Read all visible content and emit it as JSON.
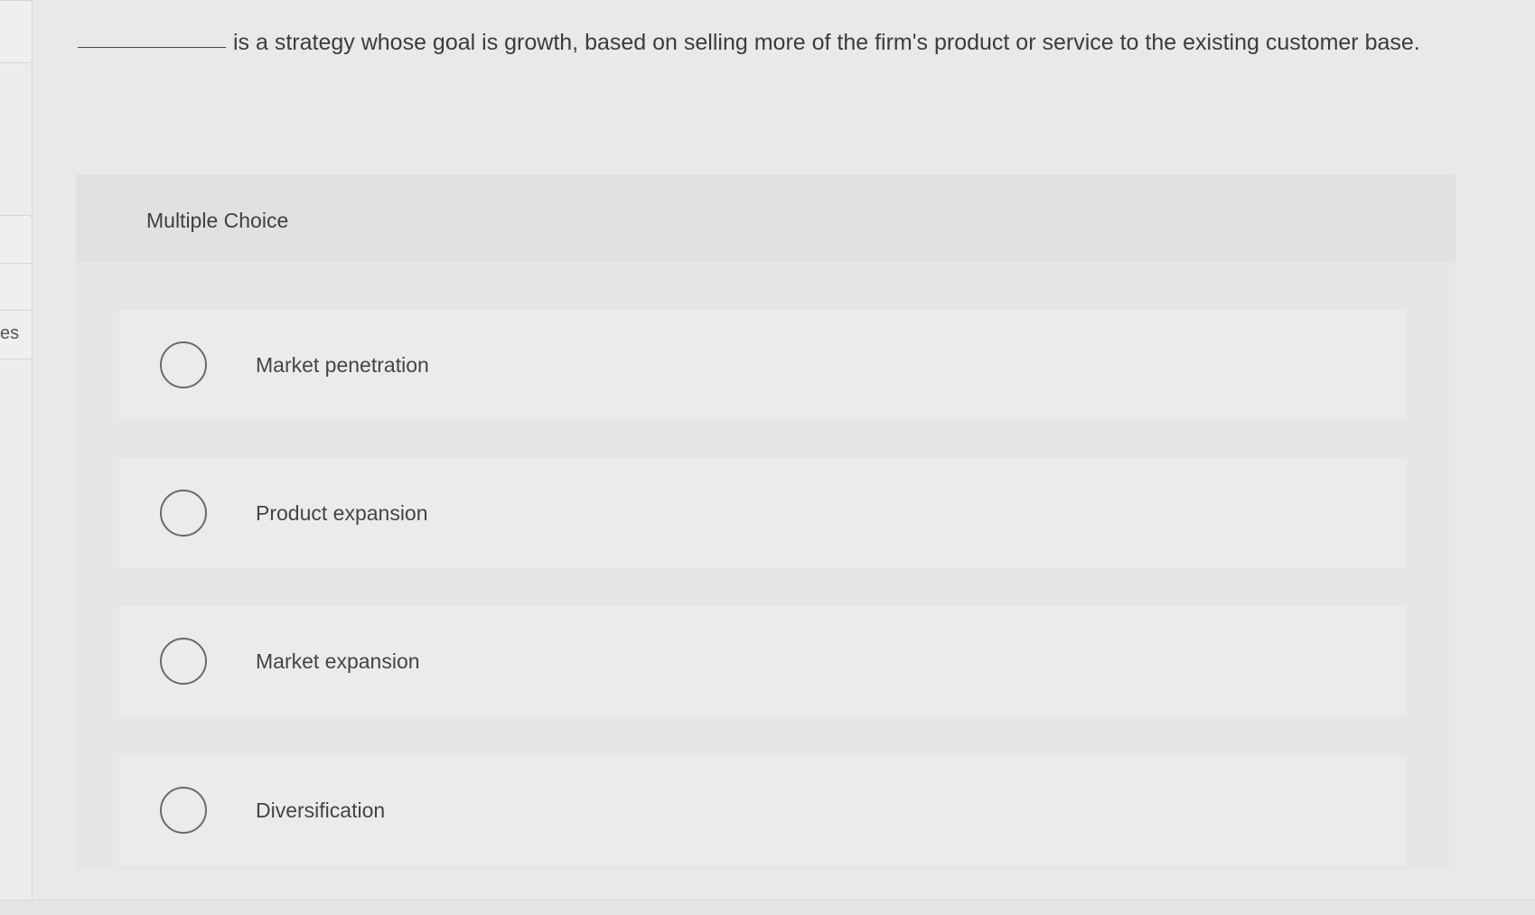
{
  "sidebar": {
    "partial_label": "es"
  },
  "question": {
    "text": "is a strategy whose goal is growth, based on selling more of the firm's product or service to the existing customer base."
  },
  "card": {
    "header": "Multiple Choice",
    "options": [
      {
        "label": "Market penetration"
      },
      {
        "label": "Product expansion"
      },
      {
        "label": "Market expansion"
      },
      {
        "label": "Diversification"
      }
    ]
  }
}
